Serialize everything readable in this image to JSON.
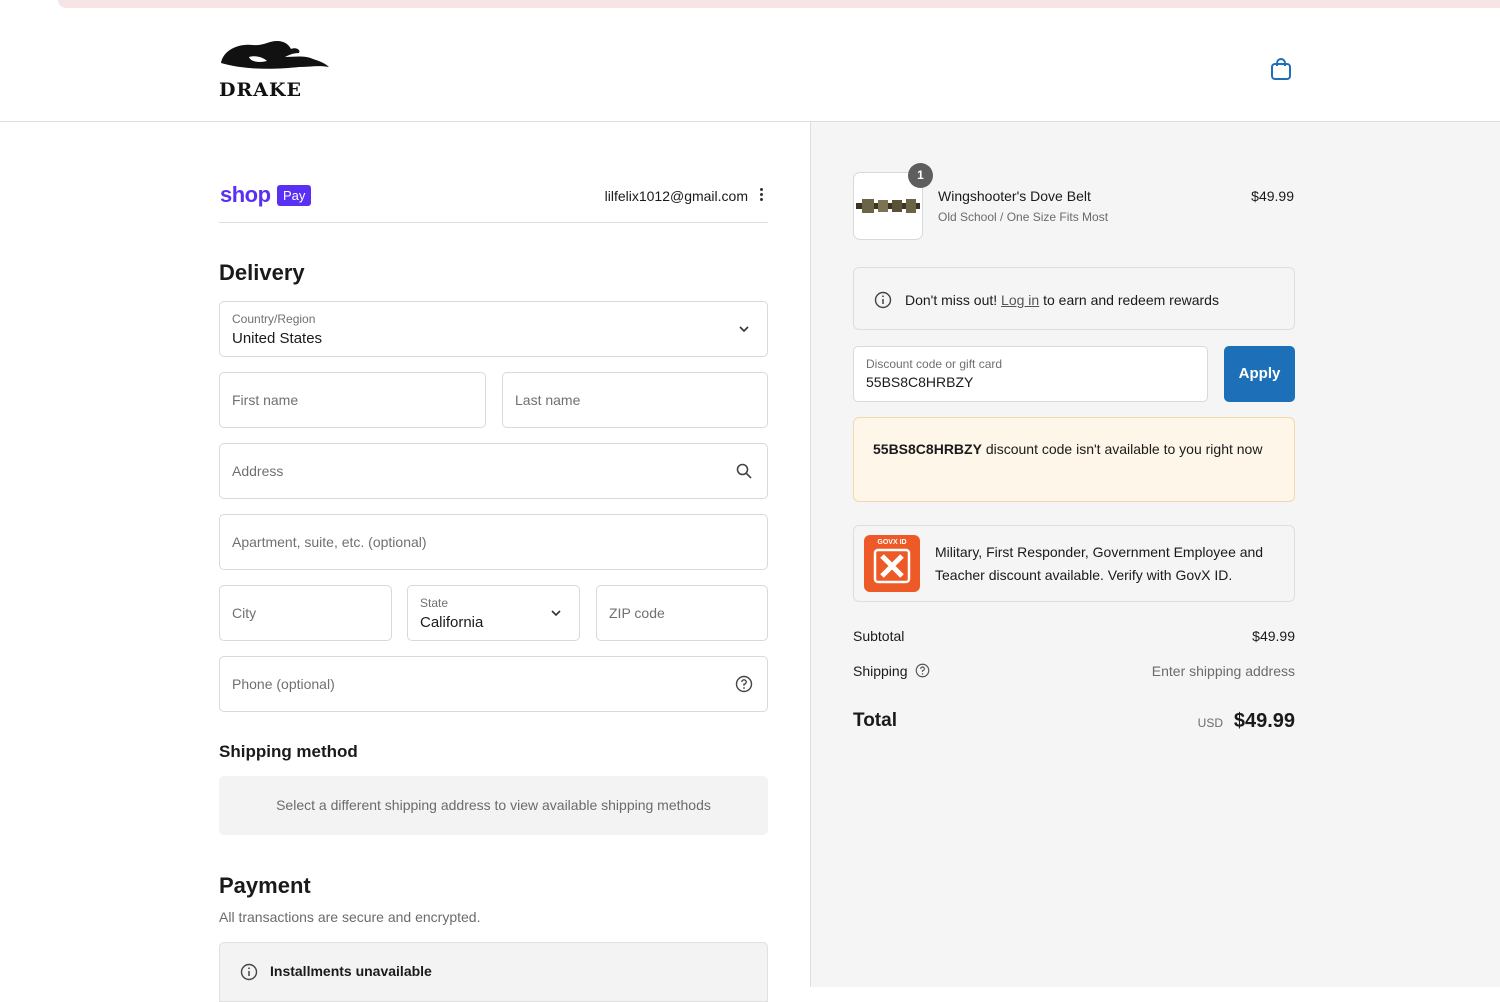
{
  "brand": {
    "logo_text": "DRAKE"
  },
  "shop_pay": {
    "shop": "shop",
    "pay": "Pay",
    "email": "lilfelix1012@gmail.com"
  },
  "delivery": {
    "title": "Delivery",
    "country": {
      "label": "Country/Region",
      "value": "United States"
    },
    "first_name": {
      "placeholder": "First name"
    },
    "last_name": {
      "placeholder": "Last name"
    },
    "address": {
      "placeholder": "Address"
    },
    "apartment": {
      "placeholder": "Apartment, suite, etc. (optional)"
    },
    "city": {
      "placeholder": "City"
    },
    "state": {
      "label": "State",
      "value": "California"
    },
    "zip": {
      "placeholder": "ZIP code"
    },
    "phone": {
      "placeholder": "Phone (optional)"
    }
  },
  "shipping_method": {
    "title": "Shipping method",
    "message": "Select a different shipping address to view available shipping methods"
  },
  "payment": {
    "title": "Payment",
    "subtitle": "All transactions are secure and encrypted.",
    "installments": "Installments unavailable"
  },
  "order": {
    "item": {
      "quantity": "1",
      "name": "Wingshooter's Dove Belt",
      "variant": "Old School / One Size Fits Most",
      "price": "$49.99"
    },
    "rewards": {
      "prefix": "Don't miss out!",
      "link": "Log in",
      "suffix": "to earn and redeem rewards"
    },
    "discount": {
      "label": "Discount code or gift card",
      "value": "55BS8C8HRBZY",
      "apply": "Apply"
    },
    "warning": {
      "code": "55BS8C8HRBZY",
      "message": "discount code isn't available to you right now"
    },
    "govx": {
      "badge_text": "GOVX ID",
      "message": "Military, First Responder, Government Employee and Teacher discount available. Verify with GovX ID."
    },
    "subtotal": {
      "label": "Subtotal",
      "value": "$49.99"
    },
    "shipping": {
      "label": "Shipping",
      "value": "Enter shipping address"
    },
    "total": {
      "label": "Total",
      "currency": "USD",
      "value": "$49.99"
    }
  },
  "colors": {
    "shop_pay_purple": "#5a31f4",
    "apply_blue": "#1d70b8",
    "govx_orange": "#ee5a27",
    "warning_bg": "#fff6ea"
  }
}
